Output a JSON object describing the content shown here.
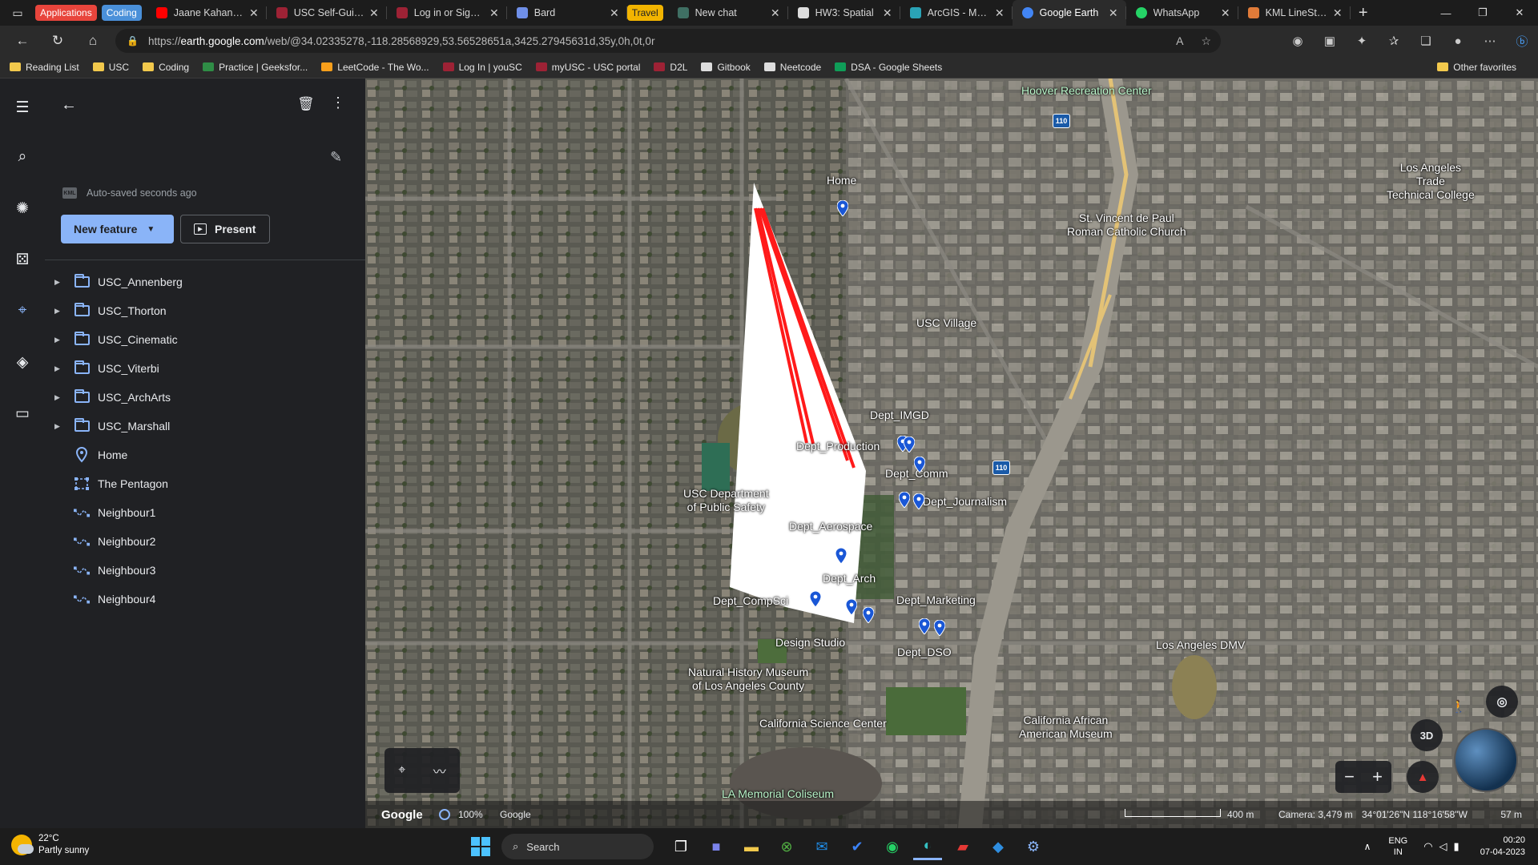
{
  "browser": {
    "tab_groups": [
      {
        "label": "Applications",
        "color": "#e8453c"
      },
      {
        "label": "Coding",
        "color": "#4a90d9"
      },
      {
        "label": "Travel",
        "color": "#f2b400"
      }
    ],
    "tabs": [
      {
        "label": "Jaane Kahan Mer",
        "icon_color": "#ff0000"
      },
      {
        "label": "USC Self-Guided",
        "icon_color": "#9d2235"
      },
      {
        "label": "Log in or Sign U",
        "icon_color": "#9d2235"
      },
      {
        "label": "Bard",
        "icon_color": "#6f8fe8"
      },
      {
        "label": "New chat",
        "icon_color": "#3f6f63"
      },
      {
        "label": "HW3: Spatial",
        "icon_color": "#dddddd"
      },
      {
        "label": "ArcGIS - My Ma",
        "icon_color": "#2aa3b6"
      },
      {
        "label": "Google Earth",
        "icon_color": "#4285f4",
        "active": true
      },
      {
        "label": "WhatsApp",
        "icon_color": "#25d366"
      },
      {
        "label": "KML LineString",
        "icon_color": "#e07b39"
      }
    ],
    "url_scheme": "https://",
    "url_host": "earth.google.com",
    "url_path": "/web/@34.02335278,-118.28568929,53.56528651a,3425.27945631d,35y,0h,0t,0r",
    "bookmarks": [
      {
        "label": "Reading List",
        "color": "#f2c94c"
      },
      {
        "label": "USC",
        "color": "#f2c94c"
      },
      {
        "label": "Coding",
        "color": "#f2c94c"
      },
      {
        "label": "Practice | Geeksfor...",
        "color": "#2f8d46"
      },
      {
        "label": "LeetCode - The Wo...",
        "color": "#f89f1b"
      },
      {
        "label": "Log In | youSC",
        "color": "#9d2235"
      },
      {
        "label": "myUSC - USC portal",
        "color": "#9d2235"
      },
      {
        "label": "D2L",
        "color": "#9d2235"
      },
      {
        "label": "Gitbook",
        "color": "#dddddd"
      },
      {
        "label": "Neetcode",
        "color": "#dddddd"
      },
      {
        "label": "DSA - Google Sheets",
        "color": "#0f9d58"
      }
    ],
    "other_favorites": "Other favorites"
  },
  "project": {
    "autosave_badge": "KML",
    "autosave": "Auto-saved seconds ago",
    "new_feature": "New feature",
    "present": "Present",
    "items": [
      {
        "label": "USC_Annenberg",
        "type": "folder"
      },
      {
        "label": "USC_Thorton",
        "type": "folder"
      },
      {
        "label": "USC_Cinematic",
        "type": "folder"
      },
      {
        "label": "USC_Viterbi",
        "type": "folder"
      },
      {
        "label": "USC_ArchArts",
        "type": "folder"
      },
      {
        "label": "USC_Marshall",
        "type": "folder"
      },
      {
        "label": "Home",
        "type": "placemark"
      },
      {
        "label": "The Pentagon",
        "type": "polygon"
      },
      {
        "label": "Neighbour1",
        "type": "line"
      },
      {
        "label": "Neighbour2",
        "type": "line"
      },
      {
        "label": "Neighbour3",
        "type": "line"
      },
      {
        "label": "Neighbour4",
        "type": "line"
      }
    ]
  },
  "map": {
    "labels": {
      "hoover": "Hoover Recreation Center",
      "la_trade": "Los Angeles\nTrade\nTechnical College",
      "st_vincent": "St. Vincent de Paul\nRoman Catholic Church",
      "usc_village": "USC Village",
      "home": "Home",
      "dept_imgd": "Dept_IMGD",
      "dept_production": "Dept_Production",
      "dept_comm": "Dept_Comm",
      "dept_journalism": "Dept_Journalism",
      "usc_dps": "USC Department\nof Public Safety",
      "dept_aerospace": "Dept_Aerospace",
      "dept_arch": "Dept_Arch",
      "dept_compsci": "Dept_CompSci",
      "dept_marketing": "Dept_Marketing",
      "design_studio": "Design Studio",
      "dept_dso": "Dept_DSO",
      "la_dmv": "Los Angeles DMV",
      "nhm": "Natural History Museum\nof Los Angeles County",
      "csc": "California Science Center",
      "caam": "California African\nAmerican Museum",
      "coliseum": "LA Memorial Coliseum",
      "hwy_1": "110",
      "hwy_2": "110"
    },
    "view_3d": "3D",
    "status": {
      "brand": "Google",
      "load_pct": "100%",
      "data_attribution": "Google",
      "scale": "400 m",
      "camera": "Camera: 3,479 m",
      "coords": "34°01'26\"N 118°16'58\"W",
      "altitude": "57 m"
    }
  },
  "taskbar": {
    "temp": "22°C",
    "weather": "Partly sunny",
    "search": "Search",
    "lang_top": "ENG",
    "lang_bottom": "IN",
    "time": "00:20",
    "date": "07-04-2023"
  }
}
